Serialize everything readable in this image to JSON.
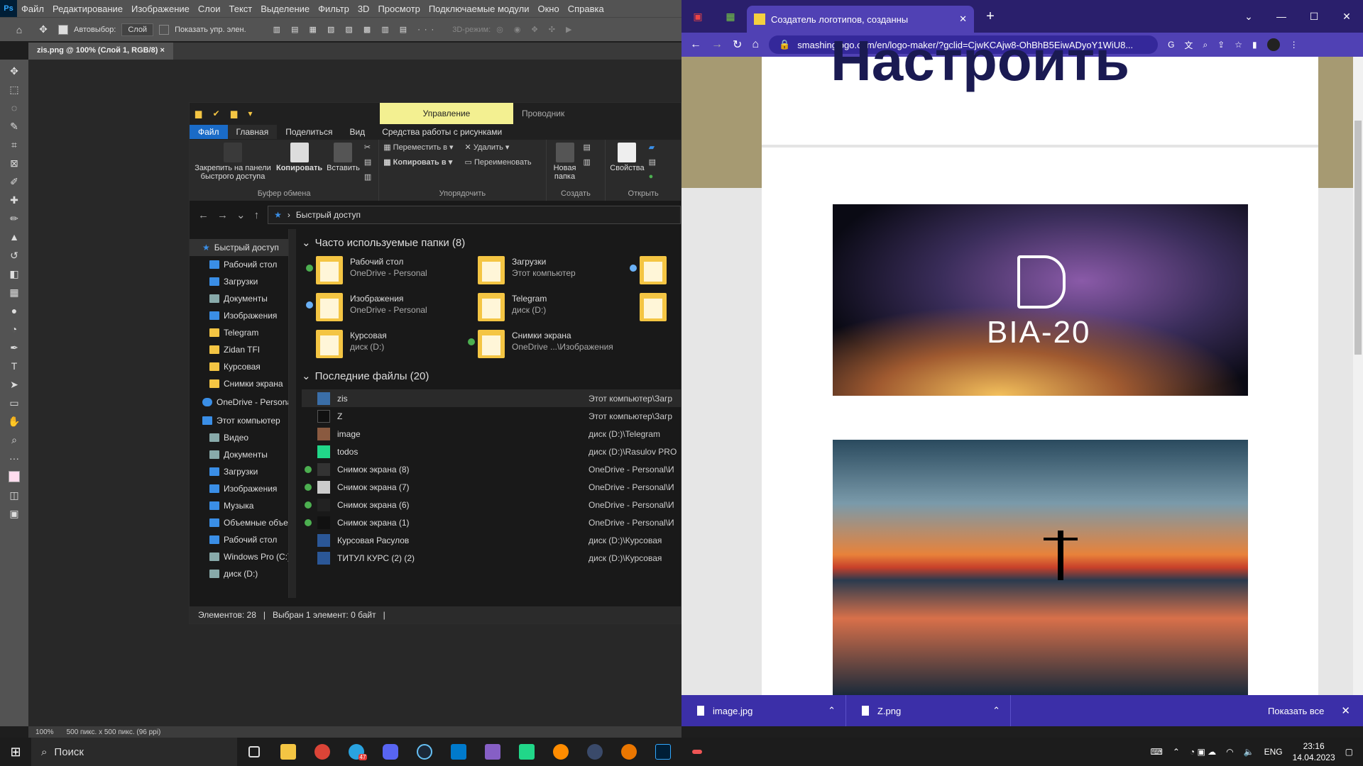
{
  "photoshop": {
    "logo": "Ps",
    "menu": [
      "Файл",
      "Редактирование",
      "Изображение",
      "Слои",
      "Текст",
      "Выделение",
      "Фильтр",
      "3D",
      "Просмотр",
      "Подключаемые модули",
      "Окно",
      "Справка"
    ],
    "options": {
      "autoselect": "Автовыбор:",
      "layer": "Слой",
      "show_controls": "Показать упр. элен.",
      "mode3d": "3D-режим:"
    },
    "doc_tab": "zis.png @ 100% (Слой 1, RGB/8)",
    "zoom": "100%",
    "doc_info": "500 пикс. x 500 пикс. (96 ppi)"
  },
  "explorer": {
    "manage_tab": "Управление",
    "app_name": "Проводник",
    "ribbon_tabs": [
      "Файл",
      "Главная",
      "Поделиться",
      "Вид",
      "Средства работы с рисунками"
    ],
    "clipboard": {
      "pin": "Закрепить на панели быстрого доступа",
      "copy": "Копировать",
      "paste": "Вставить",
      "label": "Буфер обмена"
    },
    "organize": {
      "move": "Переместить в",
      "copy_to": "Копировать в",
      "delete": "Удалить",
      "rename": "Переименовать",
      "label": "Упорядочить"
    },
    "create": {
      "new_folder": "Новая папка",
      "label": "Создать"
    },
    "open": {
      "props": "Свойства",
      "label": "Открыть"
    },
    "address": "Быстрый доступ",
    "nav": [
      {
        "label": "Быстрый доступ",
        "icon": "star",
        "top": true
      },
      {
        "label": "Рабочий стол",
        "icon": "desktop"
      },
      {
        "label": "Загрузки",
        "icon": "download"
      },
      {
        "label": "Документы",
        "icon": "docs"
      },
      {
        "label": "Изображения",
        "icon": "images"
      },
      {
        "label": "Telegram",
        "icon": "folder"
      },
      {
        "label": "Zidan TFI",
        "icon": "folder"
      },
      {
        "label": "Курсовая",
        "icon": "folder"
      },
      {
        "label": "Снимки экрана",
        "icon": "folder"
      },
      {
        "label": "OneDrive - Personal",
        "icon": "cloud",
        "top": true
      },
      {
        "label": "Этот компьютер",
        "icon": "pc",
        "top": true
      },
      {
        "label": "Видео",
        "icon": "video"
      },
      {
        "label": "Документы",
        "icon": "docs"
      },
      {
        "label": "Загрузки",
        "icon": "download"
      },
      {
        "label": "Изображения",
        "icon": "images"
      },
      {
        "label": "Музыка",
        "icon": "music"
      },
      {
        "label": "Объемные объекты",
        "icon": "3d"
      },
      {
        "label": "Рабочий стол",
        "icon": "desktop"
      },
      {
        "label": "Windows Pro (C:)",
        "icon": "drive"
      },
      {
        "label": "диск (D:)",
        "icon": "drive"
      }
    ],
    "frequent_header": "Часто используемые папки (8)",
    "frequent": [
      {
        "name": "Рабочий стол",
        "sub": "OneDrive - Personal",
        "status": "synced"
      },
      {
        "name": "Загрузки",
        "sub": "Этот компьютер",
        "status": ""
      },
      {
        "name": "Изображения",
        "sub": "OneDrive - Personal",
        "status": "cloud"
      },
      {
        "name": "Telegram",
        "sub": "диск (D:)",
        "status": ""
      },
      {
        "name": "Курсовая",
        "sub": "диск (D:)",
        "status": ""
      },
      {
        "name": "Снимки экрана",
        "sub": "OneDrive ...\\Изображения",
        "status": "synced"
      }
    ],
    "recent_header": "Последние файлы (20)",
    "recent": [
      {
        "name": "zis",
        "loc": "Этот компьютер\\Загр",
        "status": ""
      },
      {
        "name": "Z",
        "loc": "Этот компьютер\\Загр",
        "status": ""
      },
      {
        "name": "image",
        "loc": "диск (D:)\\Telegram",
        "status": ""
      },
      {
        "name": "todos",
        "loc": "диск (D:)\\Rasulov PRO",
        "status": ""
      },
      {
        "name": "Снимок экрана (8)",
        "loc": "OneDrive - Personal\\И",
        "status": "synced"
      },
      {
        "name": "Снимок экрана (7)",
        "loc": "OneDrive - Personal\\И",
        "status": "synced"
      },
      {
        "name": "Снимок экрана (6)",
        "loc": "OneDrive - Personal\\И",
        "status": "synced"
      },
      {
        "name": "Снимок экрана (1)",
        "loc": "OneDrive - Personal\\И",
        "status": "synced"
      },
      {
        "name": "Курсовая Расулов",
        "loc": "диск (D:)\\Курсовая",
        "status": ""
      },
      {
        "name": "ТИТУЛ КУРС (2) (2)",
        "loc": "диск (D:)\\Курсовая",
        "status": ""
      }
    ],
    "status": {
      "count": "Элементов: 28",
      "selected": "Выбран 1 элемент: 0 байт"
    }
  },
  "chrome": {
    "tab_title": "Создатель логотипов, созданны",
    "url": "smashinglogo.com/en/logo-maker/?gclid=CjwKCAjw8-OhBhB5EiwADyoY1WiU8...",
    "page_heading": "Настроить",
    "logo_text": "BIA-20",
    "downloads": [
      {
        "name": "image.jpg"
      },
      {
        "name": "Z.png"
      }
    ],
    "show_all": "Показать все"
  },
  "taskbar": {
    "search": "Поиск",
    "lang": "ENG",
    "time": "23:16",
    "date": "14.04.2023",
    "telegram_badge": "47"
  }
}
